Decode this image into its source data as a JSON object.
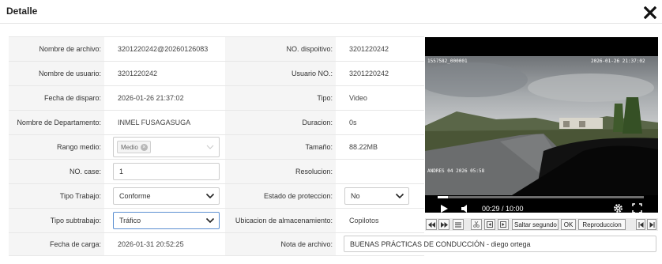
{
  "header": {
    "title": "Detalle"
  },
  "rows": [
    {
      "l1": "Nombre de archivo:",
      "v1": "3201220242@20260126083",
      "l2": "NO. dispoitivo:",
      "v2": "3201220242"
    },
    {
      "l1": "Nombre de usuario:",
      "v1": "3201220242",
      "l2": "Usuario NO.:",
      "v2": "3201220242"
    },
    {
      "l1": "Fecha de disparo:",
      "v1": "2026-01-26 21:37:02",
      "l2": "Tipo:",
      "v2": "Video"
    },
    {
      "l1": "Nombre de Departamento:",
      "v1": "INMEL FUSAGASUGA",
      "l2": "Duracion:",
      "v2": "0s"
    },
    {
      "l1": "Rango medio:",
      "v1": "Medio",
      "l2": "Tamaño:",
      "v2": "88.22MB"
    },
    {
      "l1": "NO. case:",
      "v1": "1",
      "l2": "Resolucion:",
      "v2": ""
    },
    {
      "l1": "Tipo Trabajo:",
      "v1": "Conforme",
      "l2": "Estado de proteccion:",
      "v2": "No"
    },
    {
      "l1": "Tipo subtrabajo:",
      "v1": "Tráfico",
      "l2": "Ubicacion de almacenamiento:",
      "v2": "Copilotos"
    },
    {
      "l1": "Fecha de carga:",
      "v1": "2026-01-31 20:52:25",
      "l2": "Nota de archivo:",
      "v2": "BUENAS PRÁCTICAS DE CONDUCCIÓN - diego ortega"
    }
  ],
  "video": {
    "overlay_top_left": "1557582_000001",
    "overlay_top_right": "2026-01-26 21:37:02",
    "overlay_bottom_left": "ANDRES 04 2026 05:58",
    "time": "00:29 / 10:00",
    "progress": 0.048
  },
  "toolbar": {
    "skip_label": "Saltar segundo",
    "ok_label": "OK",
    "playback_label": "Reproduccion"
  }
}
